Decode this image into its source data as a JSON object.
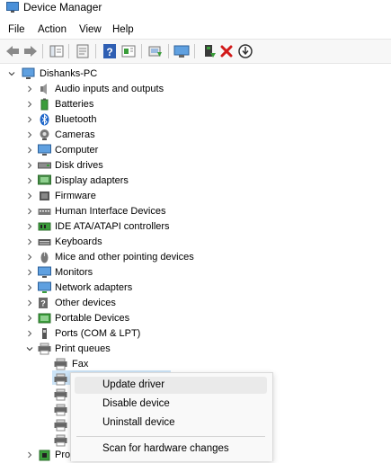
{
  "window": {
    "title": "Device Manager"
  },
  "menu": [
    "File",
    "Action",
    "View",
    "Help"
  ],
  "toolbar": {
    "buttons": [
      "back-icon",
      "forward-icon",
      "show-hide-tree-icon",
      "properties-icon",
      "help-icon",
      "action-pane-icon",
      "update-driver-icon",
      "scan-hardware-icon",
      "enable-device-icon",
      "uninstall-icon",
      "download-icon"
    ],
    "accent": "#d11a1a"
  },
  "tree": {
    "root": "Dishanks-PC",
    "categories": [
      "Audio inputs and outputs",
      "Batteries",
      "Bluetooth",
      "Cameras",
      "Computer",
      "Disk drives",
      "Display adapters",
      "Firmware",
      "Human Interface Devices",
      "IDE ATA/ATAPI controllers",
      "Keyboards",
      "Mice and other pointing devices",
      "Monitors",
      "Network adapters",
      "Other devices",
      "Portable Devices",
      "Ports (COM & LPT)",
      "Print queues"
    ],
    "print_queue_children": [
      "Fax"
    ],
    "partial_next_category": "Pro"
  },
  "context_menu": {
    "items": [
      "Update driver",
      "Disable device",
      "Uninstall device",
      "Scan for hardware changes"
    ],
    "highlight": "#cce4f7"
  }
}
